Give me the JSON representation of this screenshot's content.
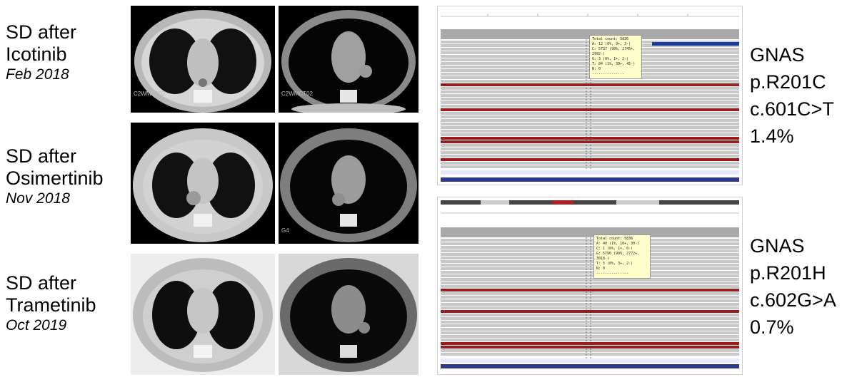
{
  "rows": [
    {
      "lines": [
        "SD after",
        "Icotinib"
      ],
      "date": "Feb 2018",
      "tag_lung": "C2WMCT02",
      "tag_med": "C2WMCT02"
    },
    {
      "lines": [
        "SD after",
        "Osimertinib"
      ],
      "date": "Nov 2018",
      "tag_lung": "",
      "tag_med": "G4"
    },
    {
      "lines": [
        "SD after",
        "Trametinib"
      ],
      "date": "Oct 2019",
      "tag_lung": "",
      "tag_med": ""
    }
  ],
  "variants": [
    {
      "gene": "GNAS",
      "protein": "p.R201C",
      "cdna": "c.601C>T",
      "vaf": "1.4%",
      "tooltip": [
        "Total count: 5836",
        "A: 12 (0%, 9+, 3-)",
        "C: 5737 (98%, 2745+, 2992-)",
        "G: 3 (0%, 1+, 2-)",
        "T: 84 (1%, 39+, 45-)",
        "N: 0",
        "---------------"
      ]
    },
    {
      "gene": "GNAS",
      "protein": "p.R201H",
      "cdna": "c.602G>A",
      "vaf": "0.7%",
      "tooltip": [
        "Total count: 5836",
        "A: 40 (1%, 10+, 30-)",
        "C: 1 (0%, 1+, 0-)",
        "G: 5790 (99%, 2772+, 3018-)",
        "T: 5 (0%, 3+, 2-)",
        "N: 0",
        "---------------"
      ]
    }
  ],
  "colors": {
    "read": "#c8c8c8",
    "read_border": "#b0b0b0",
    "highlight_row": "#9b1c1c",
    "coverage": "#a9a9a9",
    "tooltip_bg": "#ffffcc"
  }
}
